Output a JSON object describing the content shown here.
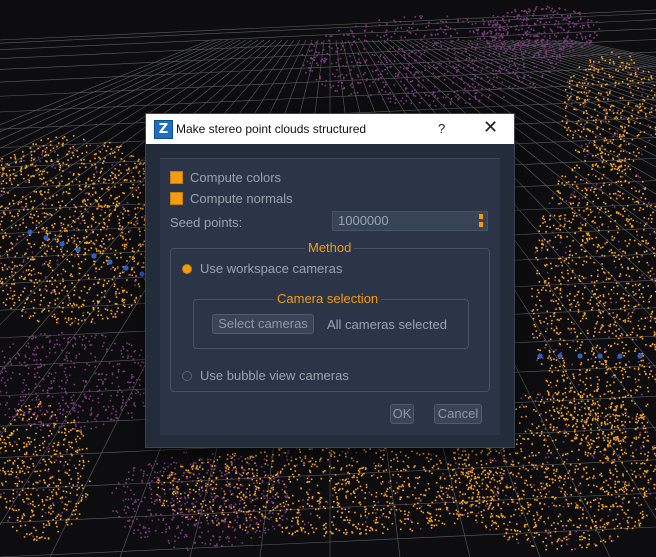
{
  "dialog": {
    "title": "Make stereo point clouds structured",
    "app_icon_letter": "Z",
    "help_label": "?",
    "close_label": "✕"
  },
  "options": {
    "compute_colors_label": "Compute colors",
    "compute_colors_checked": true,
    "compute_normals_label": "Compute normals",
    "compute_normals_checked": true,
    "seed_points_label": "Seed points:",
    "seed_points_value": "1000000"
  },
  "method": {
    "title": "Method",
    "workspace_label": "Use workspace cameras",
    "workspace_selected": true,
    "bubble_label": "Use bubble view cameras",
    "bubble_selected": false,
    "camera_selection": {
      "title": "Camera selection",
      "select_button": "Select cameras",
      "status": "All cameras selected"
    }
  },
  "buttons": {
    "ok": "OK",
    "cancel": "Cancel"
  },
  "colors": {
    "accent": "#f39c12",
    "point_orange": "#f7a51c",
    "point_purple": "#7a3a7e",
    "point_blue": "#2f5fbf",
    "background": "#0d0d0f",
    "grid": "#6f7175"
  }
}
